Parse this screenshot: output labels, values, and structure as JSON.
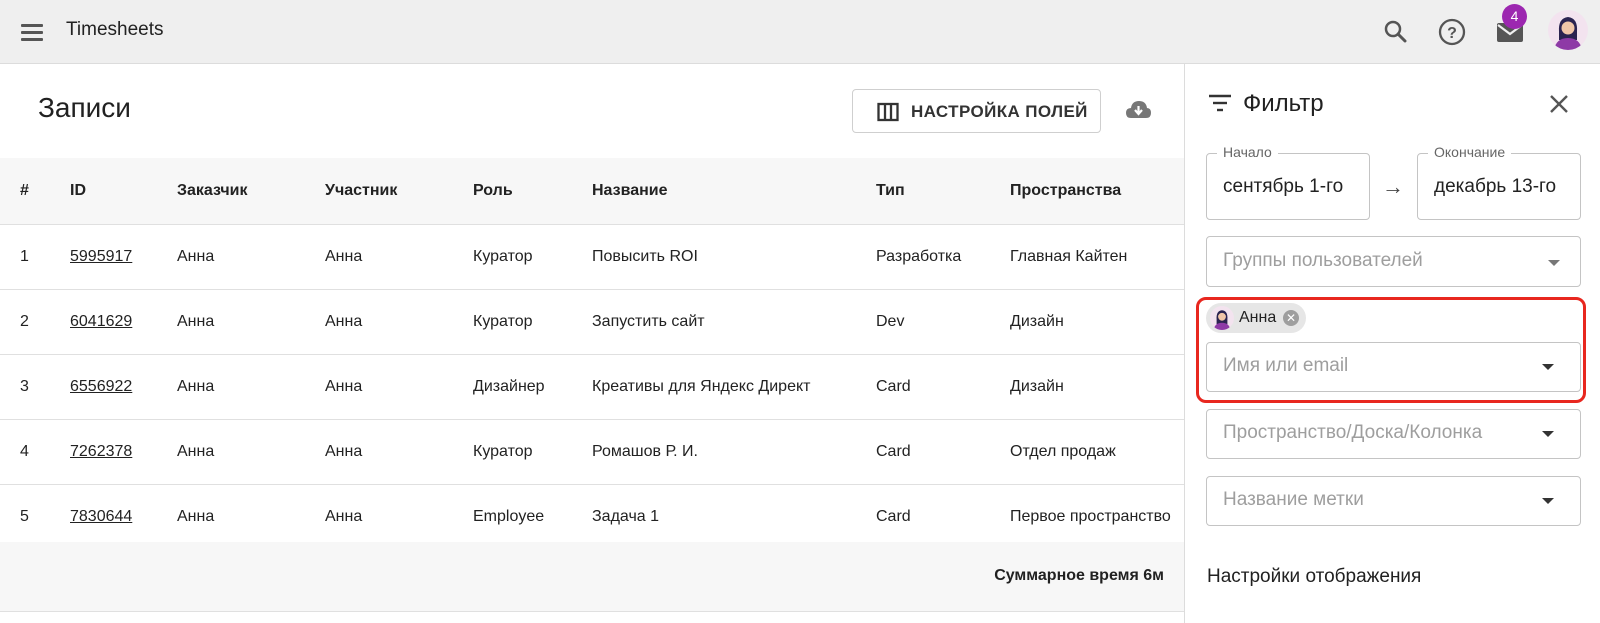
{
  "appbar": {
    "title": "Timesheets",
    "notifications_count": "4"
  },
  "main": {
    "title": "Записи",
    "fields_button_label": "НАСТРОЙКА ПОЛЕЙ",
    "columns": [
      "#",
      "ID",
      "Заказчик",
      "Участник",
      "Роль",
      "Название",
      "Тип",
      "Пространства"
    ],
    "rows": [
      [
        "1",
        "5995917",
        "Анна",
        "Анна",
        "Куратор",
        "Повысить ROI",
        "Разработка",
        "Главная Кайтен"
      ],
      [
        "2",
        "6041629",
        "Анна",
        "Анна",
        "Куратор",
        "Запустить сайт",
        "Dev",
        "Дизайн"
      ],
      [
        "3",
        "6556922",
        "Анна",
        "Анна",
        "Дизайнер",
        "Креативы для Яндекс Директ",
        "Card",
        "Дизайн"
      ],
      [
        "4",
        "7262378",
        "Анна",
        "Анна",
        "Куратор",
        "Ромашов Р. И.",
        "Card",
        "Отдел продаж"
      ],
      [
        "5",
        "7830644",
        "Анна",
        "Анна",
        "Employee",
        "Задача 1",
        "Card",
        "Первое пространство"
      ]
    ],
    "total": "Суммарное время 6м"
  },
  "filter": {
    "title": "Фильтр",
    "start_label": "Начало",
    "start_value": "сентябрь 1-го",
    "end_label": "Окончание",
    "end_value": "декабрь 13-го",
    "user_groups_placeholder": "Группы пользователей",
    "selected_user": "Анна",
    "user_search_placeholder": "Имя или email",
    "space_placeholder": "Пространство/Доска/Колонка",
    "tag_placeholder": "Название метки",
    "display_settings": "Настройки отображения"
  },
  "colors": {
    "highlight": "#e8271f",
    "badge": "#9c27b0"
  }
}
